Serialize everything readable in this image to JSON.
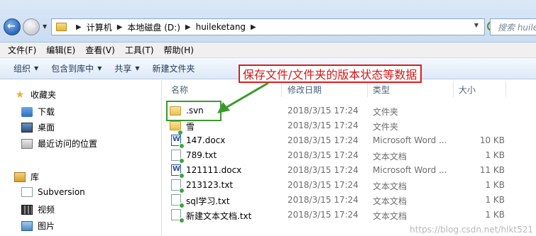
{
  "address": {
    "crumbs": [
      "计算机",
      "本地磁盘 (D:)",
      "huileketang"
    ],
    "search_placeholder": "搜索 huile"
  },
  "menu": [
    "文件(F)",
    "编辑(E)",
    "查看(V)",
    "工具(T)",
    "帮助(H)"
  ],
  "toolbar": {
    "organize": "组织",
    "include": "包含到库中",
    "share": "共享",
    "new_folder": "新建文件夹"
  },
  "annotation": {
    "text": "保存文件/文件夹的版本状态等数据",
    "color": "#e11a1a",
    "arrow_color": "#3c9a2c"
  },
  "nav": {
    "favorites": "收藏夹",
    "downloads": "下载",
    "desktop": "桌面",
    "recent": "最近访问的位置",
    "library": "库",
    "subversion": "Subversion",
    "videos": "视频",
    "pictures": "图片"
  },
  "columns": {
    "name": "名称",
    "date": "修改日期",
    "type": "类型",
    "size": "大小"
  },
  "files": [
    {
      "name": ".svn",
      "date": "2018/3/15 17:24",
      "type": "文件夹",
      "size": "",
      "icon": "folder"
    },
    {
      "name": "雪",
      "date": "2018/3/15 17:24",
      "type": "文件夹",
      "size": "",
      "icon": "folder"
    },
    {
      "name": "147.docx",
      "date": "2018/3/15 17:24",
      "type": "Microsoft Word ...",
      "size": "10 KB",
      "icon": "word"
    },
    {
      "name": "789.txt",
      "date": "2018/3/15 17:24",
      "type": "文本文档",
      "size": "1 KB",
      "icon": "txt"
    },
    {
      "name": "121111.docx",
      "date": "2018/3/15 17:24",
      "type": "Microsoft Word ...",
      "size": "11 KB",
      "icon": "word"
    },
    {
      "name": "213123.txt",
      "date": "2018/3/15 17:24",
      "type": "文本文档",
      "size": "1 KB",
      "icon": "txt"
    },
    {
      "name": "sql学习.txt",
      "date": "2018/3/15 17:24",
      "type": "文本文档",
      "size": "1 KB",
      "icon": "txt"
    },
    {
      "name": "新建文本文档.txt",
      "date": "2018/3/15 17:24",
      "type": "文本文档",
      "size": "1 KB",
      "icon": "txt"
    }
  ],
  "watermark": "https://blog.csdn.net/hlkt521"
}
